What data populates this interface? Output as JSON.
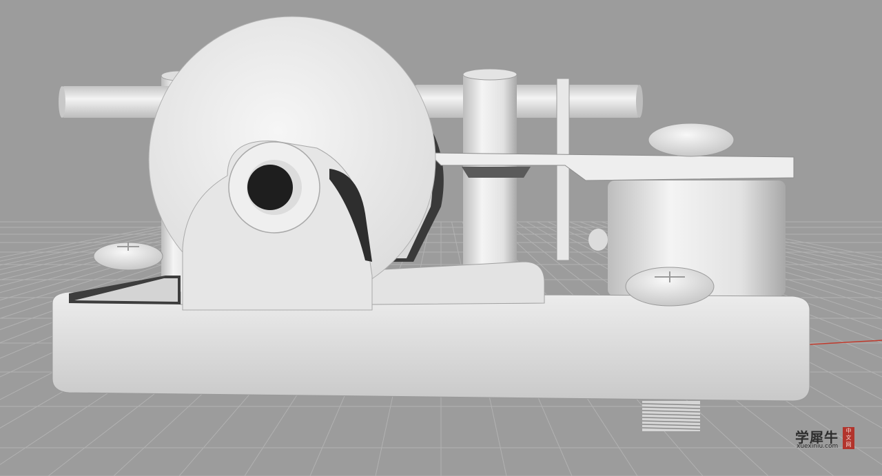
{
  "scene": {
    "subject": "music-box-movement-model",
    "colors": {
      "background": "#9c9c9c",
      "grid_line": "#b4b4b4",
      "model": "#e6e6e6",
      "model_shadow": "#b8b8b8",
      "axis_x": "#c0392b"
    },
    "grid": "visible",
    "axis_marker": "red-x-axis"
  },
  "watermark": {
    "chinese": "学犀牛",
    "url": "xuexiniu.com",
    "seal": [
      "中",
      "文",
      "网"
    ]
  }
}
